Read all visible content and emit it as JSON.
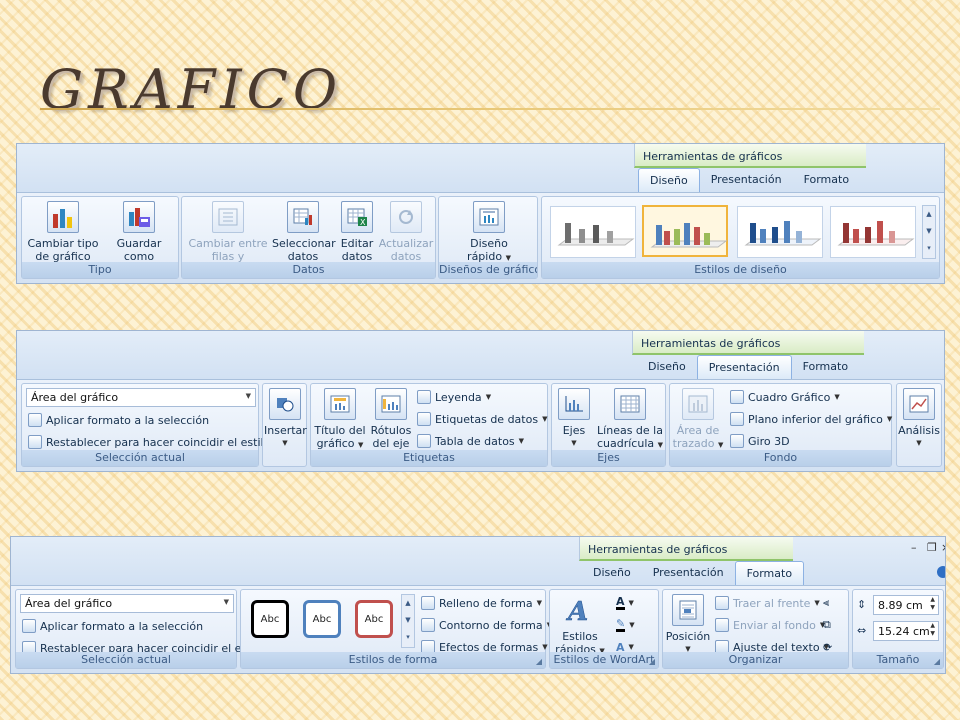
{
  "slide": {
    "title": "GRAFICO"
  },
  "ribbon1": {
    "context_header": "Herramientas de gráficos",
    "tabs": [
      "Diseño",
      "Presentación",
      "Formato"
    ],
    "groups": {
      "tipo": {
        "label": "Tipo",
        "buttons": [
          "Cambiar tipo de gráfico",
          "Guardar como plantilla"
        ]
      },
      "datos": {
        "label": "Datos",
        "buttons": [
          "Cambiar entre filas y columnas",
          "Seleccionar datos",
          "Editar datos",
          "Actualizar datos"
        ]
      },
      "disenos": {
        "label": "Diseños de gráfico",
        "buttons": [
          "Diseño rápido"
        ]
      },
      "estilos": {
        "label": "Estilos de diseño",
        "styles": [
          "gray",
          "multicolor",
          "blue",
          "red"
        ]
      }
    }
  },
  "ribbon2": {
    "context_header": "Herramientas de gráficos",
    "tabs": [
      "Diseño",
      "Presentación",
      "Formato"
    ],
    "groups": {
      "seleccion": {
        "label": "Selección actual",
        "combo_value": "Área del gráfico",
        "items": [
          "Aplicar formato a la selección",
          "Restablecer para hacer coincidir el estilo"
        ]
      },
      "insertar": {
        "label": "Insertar"
      },
      "etiquetas": {
        "label": "Etiquetas",
        "big": [
          "Título del gráfico",
          "Rótulos del eje"
        ],
        "small": [
          "Leyenda",
          "Etiquetas de datos",
          "Tabla de datos"
        ]
      },
      "ejes": {
        "label": "Ejes",
        "buttons": [
          "Ejes",
          "Líneas de la cuadrícula"
        ]
      },
      "fondo": {
        "label": "Fondo",
        "big": "Área de trazado",
        "small": [
          "Cuadro Gráfico",
          "Plano inferior del gráfico",
          "Giro 3D"
        ]
      },
      "analisis": {
        "label": "Análisis"
      }
    }
  },
  "ribbon3": {
    "context_header": "Herramientas de gráficos",
    "tabs": [
      "Diseño",
      "Presentación",
      "Formato"
    ],
    "window_controls": {
      "minimize": "–",
      "restore": "❐",
      "close": "×"
    },
    "groups": {
      "seleccion": {
        "label": "Selección actual",
        "combo_value": "Área del gráfico",
        "items": [
          "Aplicar formato a la selección",
          "Restablecer para hacer coincidir el estilo"
        ]
      },
      "estilos_forma": {
        "label": "Estilos de forma",
        "thumb_text": "Abc",
        "thumb_colors": [
          "#000000",
          "#4f81bd",
          "#c0504d"
        ],
        "small": [
          "Relleno de forma",
          "Contorno de forma",
          "Efectos de formas"
        ]
      },
      "wordart": {
        "label": "Estilos de WordArt",
        "button": "Estilos rápidos"
      },
      "organizar": {
        "label": "Organizar",
        "big": "Posición",
        "small": [
          "Traer al frente",
          "Enviar al fondo",
          "Ajuste del texto"
        ]
      },
      "tamano": {
        "label": "Tamaño",
        "height": "8.89 cm",
        "width": "15.24 cm"
      }
    }
  }
}
